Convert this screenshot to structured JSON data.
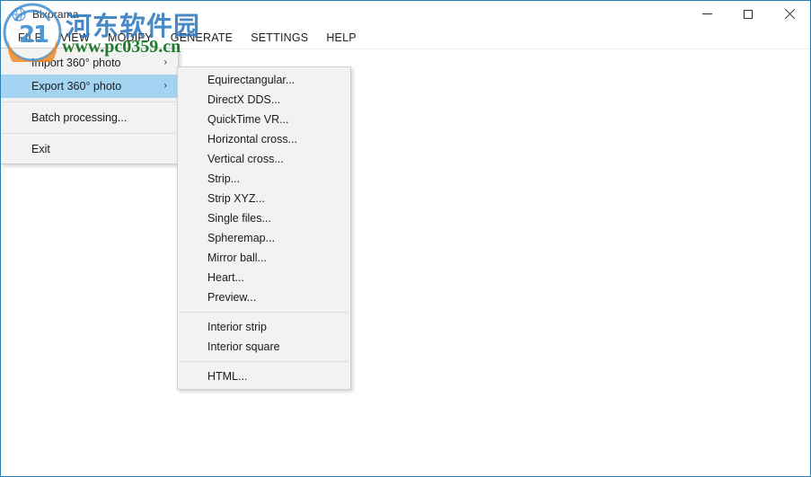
{
  "window": {
    "title": "Bixorama",
    "icon": "app-globe-icon",
    "border_color": "#2e7cb0",
    "controls": {
      "minimize": "—",
      "maximize": "□",
      "close": "✕"
    }
  },
  "menubar": {
    "items": [
      {
        "label": "FILE",
        "active": true
      },
      {
        "label": "VIEW",
        "active": false
      },
      {
        "label": "MODIFY",
        "active": false
      },
      {
        "label": "GENERATE",
        "active": false
      },
      {
        "label": "SETTINGS",
        "active": false
      },
      {
        "label": "HELP",
        "active": false
      }
    ]
  },
  "file_menu": {
    "highlight_color": "#a3d5f3",
    "items": [
      {
        "label": "Import 360° photo",
        "has_submenu": true,
        "selected": false,
        "arrow": "›"
      },
      {
        "label": "Export 360° photo",
        "has_submenu": true,
        "selected": true,
        "arrow": "›"
      },
      {
        "separator": true
      },
      {
        "label": "Batch processing...",
        "has_submenu": false,
        "selected": false
      },
      {
        "separator": true
      },
      {
        "label": "Exit",
        "has_submenu": false,
        "selected": false
      }
    ]
  },
  "export_submenu": {
    "items": [
      {
        "label": "Equirectangular..."
      },
      {
        "label": "DirectX DDS..."
      },
      {
        "label": "QuickTime VR..."
      },
      {
        "label": "Horizontal cross..."
      },
      {
        "label": "Vertical cross..."
      },
      {
        "label": "Strip..."
      },
      {
        "label": "Strip XYZ..."
      },
      {
        "label": "Single files..."
      },
      {
        "label": "Spheremap..."
      },
      {
        "label": "Mirror ball..."
      },
      {
        "label": "Heart..."
      },
      {
        "label": "Preview..."
      },
      {
        "separator": true
      },
      {
        "label": "Interior strip"
      },
      {
        "label": "Interior square"
      },
      {
        "separator": true
      },
      {
        "label": "HTML..."
      }
    ]
  },
  "watermark": {
    "site_name": "河东软件园",
    "url": "www.pc0359.cn",
    "text_color": "#2f78bd",
    "url_color": "#1f7a2e"
  }
}
